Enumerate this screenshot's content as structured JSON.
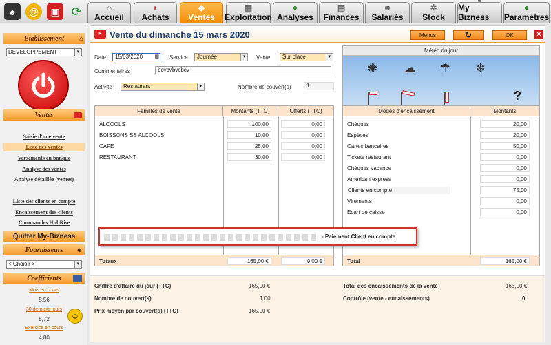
{
  "top_icons": [
    "tuxedo-icon",
    "at-sign-icon",
    "delivery-box-icon",
    "refresh-arrows-icon"
  ],
  "tabs": [
    {
      "label": "Accueil"
    },
    {
      "label": "Achats"
    },
    {
      "label": "Ventes"
    },
    {
      "label": "Exploitation"
    },
    {
      "label": "Analyses"
    },
    {
      "label": "Finances"
    },
    {
      "label": "Salariés"
    },
    {
      "label": "Stock"
    },
    {
      "label": "My Bizness"
    },
    {
      "label": "Paramètres"
    }
  ],
  "active_tab": "Ventes",
  "sidebar": {
    "etab_title": "Etablissement",
    "etab_value": "DEVELOPPEMENT",
    "ventes_title": "Ventes",
    "links1": [
      "Saisie d'une vente",
      "Liste des ventes",
      "Versements en banque",
      "Analyse des ventes",
      "Analyse détaillée (ventes)"
    ],
    "links2": [
      "Liste des clients en compte",
      "Encaissement des clients",
      "Commandes HubRise"
    ],
    "quit": "Quitter My-Bizness",
    "fourn_title": "Fournisseurs",
    "fourn_value": "< Choisir >",
    "coef_title": "Coefficients",
    "coef": [
      {
        "label": "Mois en cours",
        "value": "5,56"
      },
      {
        "label": "30 derniers jours",
        "value": "5,72"
      },
      {
        "label": "Exercice en cours",
        "value": "4,80"
      }
    ]
  },
  "main": {
    "title": "Vente du dimanche 15 mars 2020",
    "btn_menus": "Menus",
    "btn_ok": "OK",
    "date_label": "Date",
    "date_value": "15/03/2020",
    "service_label": "Service",
    "service_value": "Journée",
    "vente_label": "Vente",
    "vente_value": "Sur place",
    "comment_label": "Commentaires",
    "comment_value": "bcvbvbvcbcv",
    "activite_label": "Activité",
    "activite_value": "Restaurant",
    "couverts_label": "Nombre de couvert(s)",
    "couverts_value": "1",
    "meteo_title": "Météo du jour",
    "meteo_unknown": "?",
    "left_table": {
      "headers": [
        "Familles de vente",
        "Montants (TTC)",
        "Offerts (TTC)"
      ],
      "rows": [
        {
          "name": "ALCOOLS",
          "amount": "100,00",
          "offert": "0,00"
        },
        {
          "name": "BOISSONS SS ALCOOLS",
          "amount": "10,00",
          "offert": "0,00"
        },
        {
          "name": "CAFE",
          "amount": "25,00",
          "offert": "0,00"
        },
        {
          "name": "RESTAURANT",
          "amount": "30,00",
          "offert": "0,00"
        }
      ],
      "total_label": "Totaux",
      "total_amount": "165,00 €",
      "total_offert": "0,00 €"
    },
    "right_table": {
      "headers": [
        "Modes d'encaissement",
        "Montants"
      ],
      "rows": [
        {
          "name": "Chèques",
          "amount": "20,00"
        },
        {
          "name": "Espèces",
          "amount": "20,00"
        },
        {
          "name": "Cartes bancaires",
          "amount": "50,00"
        },
        {
          "name": "Tickets restaurant",
          "amount": "0,00"
        },
        {
          "name": "Chèques vacance",
          "amount": "0,00"
        },
        {
          "name": "American express",
          "amount": "0,00"
        },
        {
          "name": "Clients en compte",
          "amount": "75,00"
        },
        {
          "name": "Virements",
          "amount": "0,00"
        },
        {
          "name": "Ecart de caisse",
          "amount": "0,00"
        }
      ],
      "total_label": "Total",
      "total_amount": "165,00 €"
    },
    "popup_text": "- Paiement Client en compte",
    "summary": [
      {
        "label": "Chiffre d'affaire du jour (TTC)",
        "value": "165,00 €"
      },
      {
        "label": "Nombre de couvert(s)",
        "value": "1.00"
      },
      {
        "label": "Prix moyen par couvert(s) (TTC)",
        "value": "165,00 €"
      }
    ],
    "summary_right": [
      {
        "label": "Total des encaissements de la vente",
        "value": "165,00 €"
      },
      {
        "label": "Contrôle (vente - encaissements)",
        "value": "0"
      }
    ]
  }
}
